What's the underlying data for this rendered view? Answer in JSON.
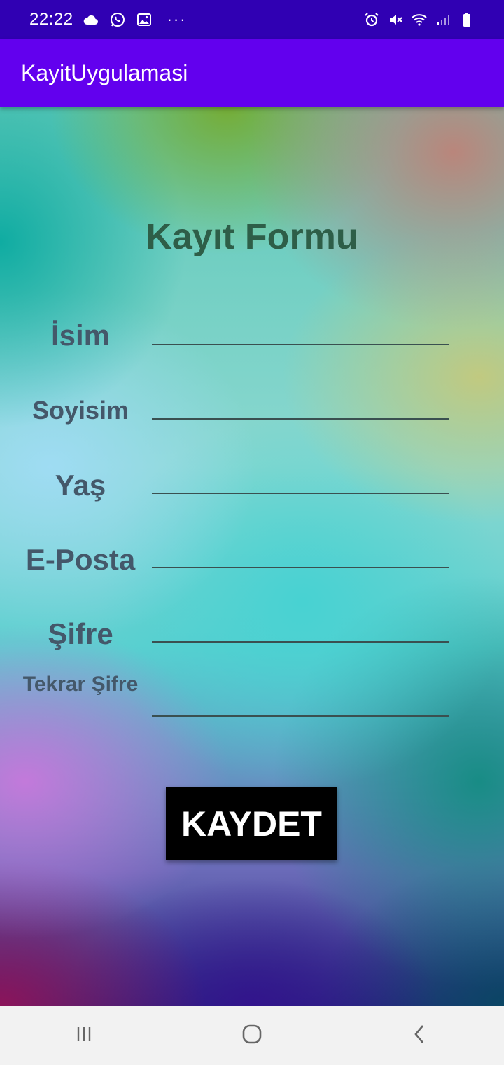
{
  "status_bar": {
    "time": "22:22",
    "left_icons": [
      "cloud-icon",
      "whatsapp-icon",
      "image-icon",
      "more-dots-icon"
    ],
    "right_icons": [
      "alarm-icon",
      "mute-icon",
      "wifi-icon",
      "signal-icon",
      "battery-icon"
    ],
    "more": "···"
  },
  "app_bar": {
    "title": "KayitUygulamasi"
  },
  "form": {
    "title": "Kayıt Formu",
    "fields": [
      {
        "label": "İsim",
        "value": ""
      },
      {
        "label": "Soyisim",
        "value": ""
      },
      {
        "label": "Yaş",
        "value": ""
      },
      {
        "label": "E-Posta",
        "value": ""
      },
      {
        "label": "Şifre",
        "value": ""
      },
      {
        "label": "Tekrar Şifre",
        "value": ""
      }
    ],
    "button_label": "KAYDET"
  },
  "nav_bar": {
    "buttons": [
      "recents-icon",
      "home-icon",
      "back-icon"
    ]
  },
  "colors": {
    "status_bar": "#3000b3",
    "app_bar": "#6200ee",
    "title_text": "#2e5e48",
    "label_text": "#44586a",
    "button_bg": "#000000"
  }
}
